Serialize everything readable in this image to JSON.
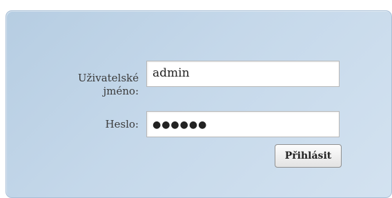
{
  "login_form": {
    "username_label": "Uživatelské jméno:",
    "username_value": "admin",
    "password_label": "Heslo:",
    "password_masked": "●●●●●●",
    "submit_label": "Přihlásit"
  }
}
